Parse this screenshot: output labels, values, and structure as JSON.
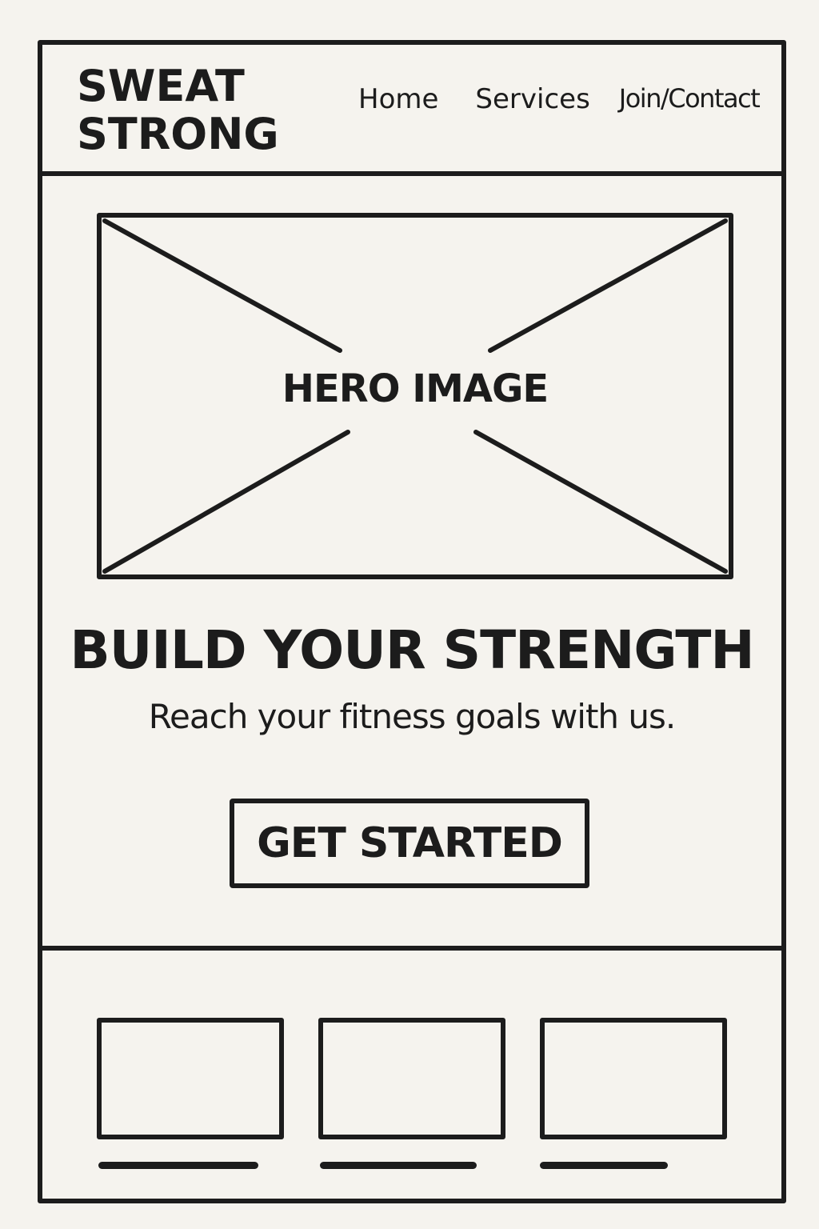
{
  "header": {
    "logo": "SWEAT\nSTRONG",
    "nav": {
      "home": "Home",
      "services": "Services",
      "join_contact": "Join/Contact"
    }
  },
  "hero": {
    "image_label": "HERO IMAGE",
    "headline": "BUILD YOUR STRENGTH",
    "subheadline": "Reach your fitness goals with us.",
    "cta_label": "GET STARTED"
  },
  "colors": {
    "ink": "#1c1c1c",
    "paper": "#f5f3ee"
  }
}
